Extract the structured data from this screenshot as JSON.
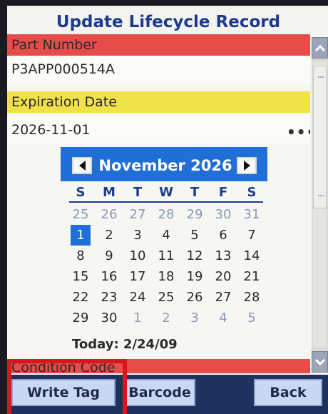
{
  "window": {
    "title": "Update Lifecycle Record"
  },
  "form": {
    "part_number_label": "Part Number",
    "part_number_value": "P3APP000514A",
    "expiration_label": "Expiration Date",
    "expiration_value": "2026-11-01",
    "condition_label": "Condition Code",
    "more_icon_glyph": "•••"
  },
  "calendar": {
    "month_title": "November 2026",
    "weekdays": [
      "S",
      "M",
      "T",
      "W",
      "T",
      "F",
      "S"
    ],
    "today_text": "Today: 2/24/09",
    "days": [
      {
        "label": "25",
        "other": true
      },
      {
        "label": "26",
        "other": true
      },
      {
        "label": "27",
        "other": true
      },
      {
        "label": "28",
        "other": true
      },
      {
        "label": "29",
        "other": true
      },
      {
        "label": "30",
        "other": true
      },
      {
        "label": "31",
        "other": true
      },
      {
        "label": "1",
        "selected": true
      },
      {
        "label": "2"
      },
      {
        "label": "3"
      },
      {
        "label": "4"
      },
      {
        "label": "5"
      },
      {
        "label": "6"
      },
      {
        "label": "7"
      },
      {
        "label": "8"
      },
      {
        "label": "9"
      },
      {
        "label": "10"
      },
      {
        "label": "11"
      },
      {
        "label": "12"
      },
      {
        "label": "13"
      },
      {
        "label": "14"
      },
      {
        "label": "15"
      },
      {
        "label": "16"
      },
      {
        "label": "17"
      },
      {
        "label": "18"
      },
      {
        "label": "19"
      },
      {
        "label": "20"
      },
      {
        "label": "21"
      },
      {
        "label": "22"
      },
      {
        "label": "23"
      },
      {
        "label": "24"
      },
      {
        "label": "25"
      },
      {
        "label": "26"
      },
      {
        "label": "27"
      },
      {
        "label": "28"
      },
      {
        "label": "29"
      },
      {
        "label": "30"
      },
      {
        "label": "1",
        "other": true
      },
      {
        "label": "2",
        "other": true
      },
      {
        "label": "3",
        "other": true
      },
      {
        "label": "4",
        "other": true
      },
      {
        "label": "5",
        "other": true
      }
    ]
  },
  "buttons": {
    "write_tag": "Write Tag",
    "barcode": "Barcode",
    "back": "Back"
  },
  "icons": {
    "prev": "triangle-left-icon",
    "next": "triangle-right-icon",
    "scroll_up": "chevron-up-icon",
    "scroll_down": "chevron-down-icon",
    "more": "ellipsis-icon"
  },
  "colors": {
    "title": "#1e3a8c",
    "label_red": "#e64c4a",
    "label_yellow": "#f2e24a",
    "calendar_header": "#1f6fd6",
    "selected_day": "#1f6fd6",
    "button_bar": "#21315e",
    "button_face": "#c8d8f4",
    "highlight": "#d9161e"
  }
}
